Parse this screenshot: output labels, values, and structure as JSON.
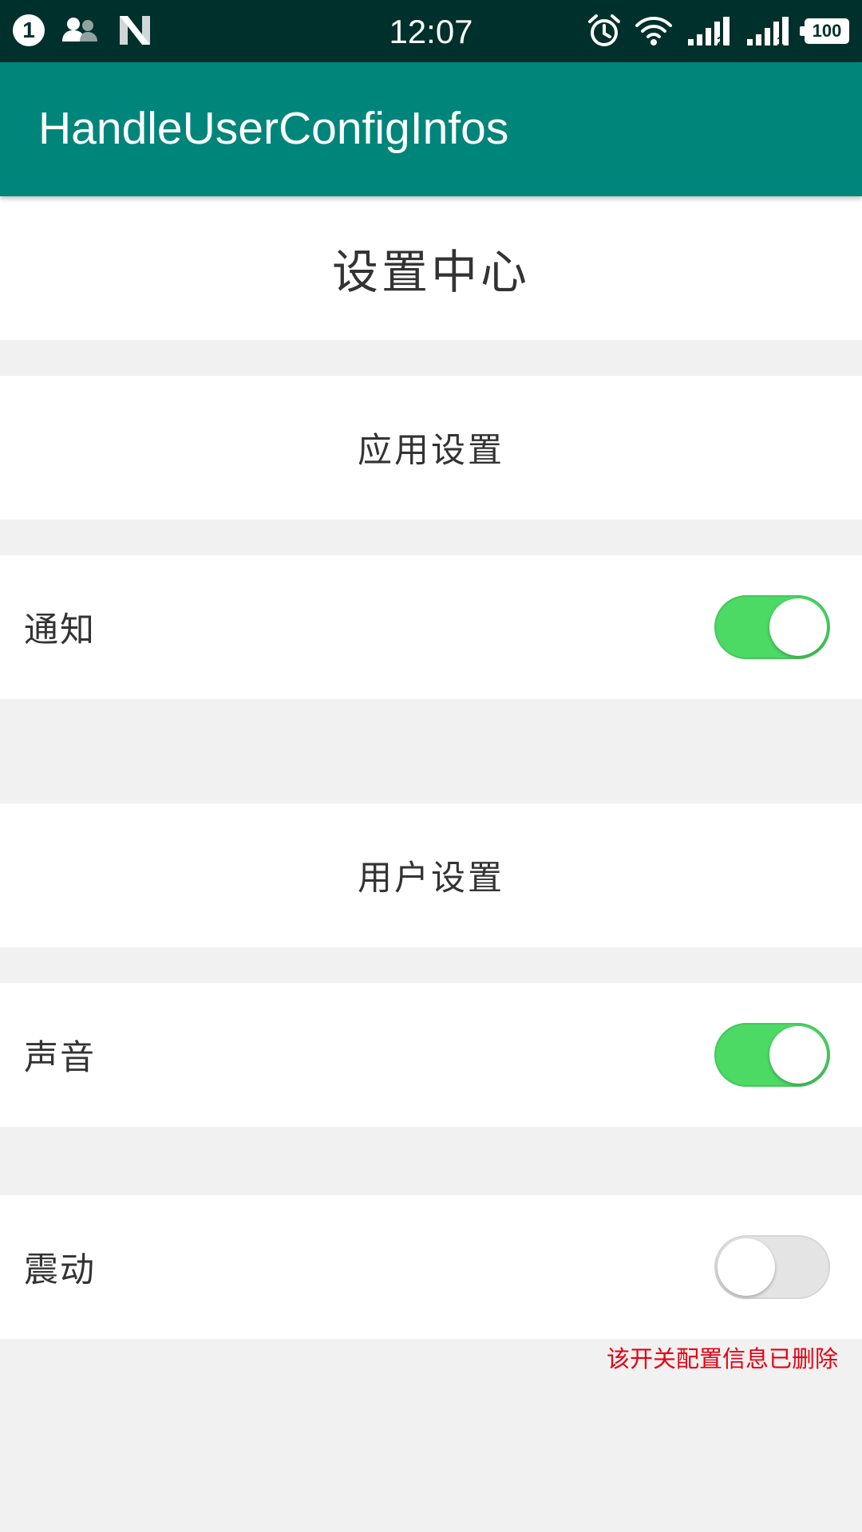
{
  "status_bar": {
    "notification_count": "1",
    "time": "12:07",
    "battery": "100",
    "left_icons": [
      "contacts-icon",
      "n-logo-icon"
    ],
    "right_icons": [
      "alarm-icon",
      "wifi-icon",
      "signal-sim2-icon",
      "signal-sim1-icon"
    ],
    "sim_labels": [
      "2",
      "1"
    ]
  },
  "app_bar": {
    "title": "HandleUserConfigInfos",
    "color": "#00857a"
  },
  "page": {
    "heading": "设置中心"
  },
  "sections": [
    {
      "title": "应用设置",
      "items": [
        {
          "label": "通知",
          "enabled": true
        }
      ]
    },
    {
      "title": "用户设置",
      "items": [
        {
          "label": "声音",
          "enabled": true
        },
        {
          "label": "震动",
          "enabled": false,
          "note": "该开关配置信息已删除"
        }
      ]
    }
  ],
  "colors": {
    "switch_on": "#4cd964",
    "switch_off": "#e4e4e4",
    "status_bar": "#00302b",
    "note_text": "#e60012"
  }
}
